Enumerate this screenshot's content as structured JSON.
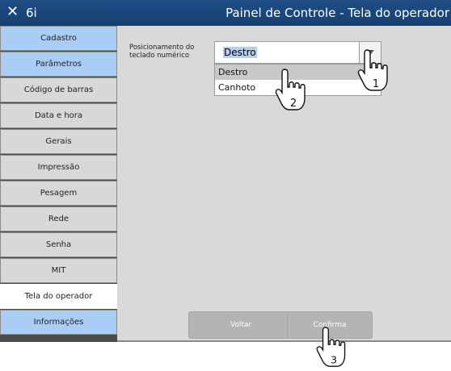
{
  "titlebar": {
    "close_glyph": "✕",
    "app_name": "6i",
    "title": "Painel de Controle - Tela do operador"
  },
  "sidebar": {
    "items": [
      {
        "label": "Cadastro"
      },
      {
        "label": "Parâmetros"
      },
      {
        "label": "Código de barras"
      },
      {
        "label": "Data e hora"
      },
      {
        "label": "Gerais"
      },
      {
        "label": "Impressão"
      },
      {
        "label": "Pesagem"
      },
      {
        "label": "Rede"
      },
      {
        "label": "Senha"
      },
      {
        "label": "MIT"
      },
      {
        "label": "Tela do operador"
      },
      {
        "label": "Informações"
      }
    ]
  },
  "form": {
    "label": "Posicionamento do teclado numérico",
    "value": "Destro",
    "options": [
      "Destro",
      "Canhoto"
    ]
  },
  "buttons": {
    "voltar": "Voltar",
    "confirma": "Confirma"
  },
  "callouts": [
    "1",
    "2",
    "3"
  ],
  "colors": {
    "titlebar": "#1e4e86",
    "sidebar_blue": "#a9cdf4",
    "sidebar_gray": "#d8d8d8",
    "panel": "#d9d9d9",
    "button": "#b4b4b4"
  }
}
